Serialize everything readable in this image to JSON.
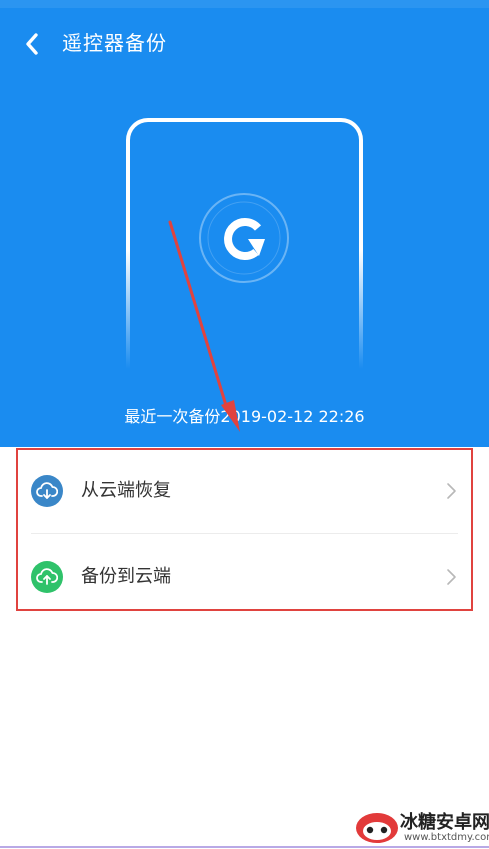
{
  "header": {
    "title": "遥控器备份"
  },
  "hero": {
    "last_backup_text": "最近一次备份2019-02-12 22:26"
  },
  "list": {
    "items": [
      {
        "label": "从云端恢复",
        "icon": "cloud-download-icon",
        "icon_bg": "#3a87c8"
      },
      {
        "label": "备份到云端",
        "icon": "cloud-upload-icon",
        "icon_bg": "#2fc26a"
      }
    ]
  },
  "watermark": {
    "name": "冰糖安卓网",
    "url": "www.btxtdmy.com"
  },
  "colors": {
    "accent": "#1a8cf0",
    "highlight": "#e0433f"
  }
}
